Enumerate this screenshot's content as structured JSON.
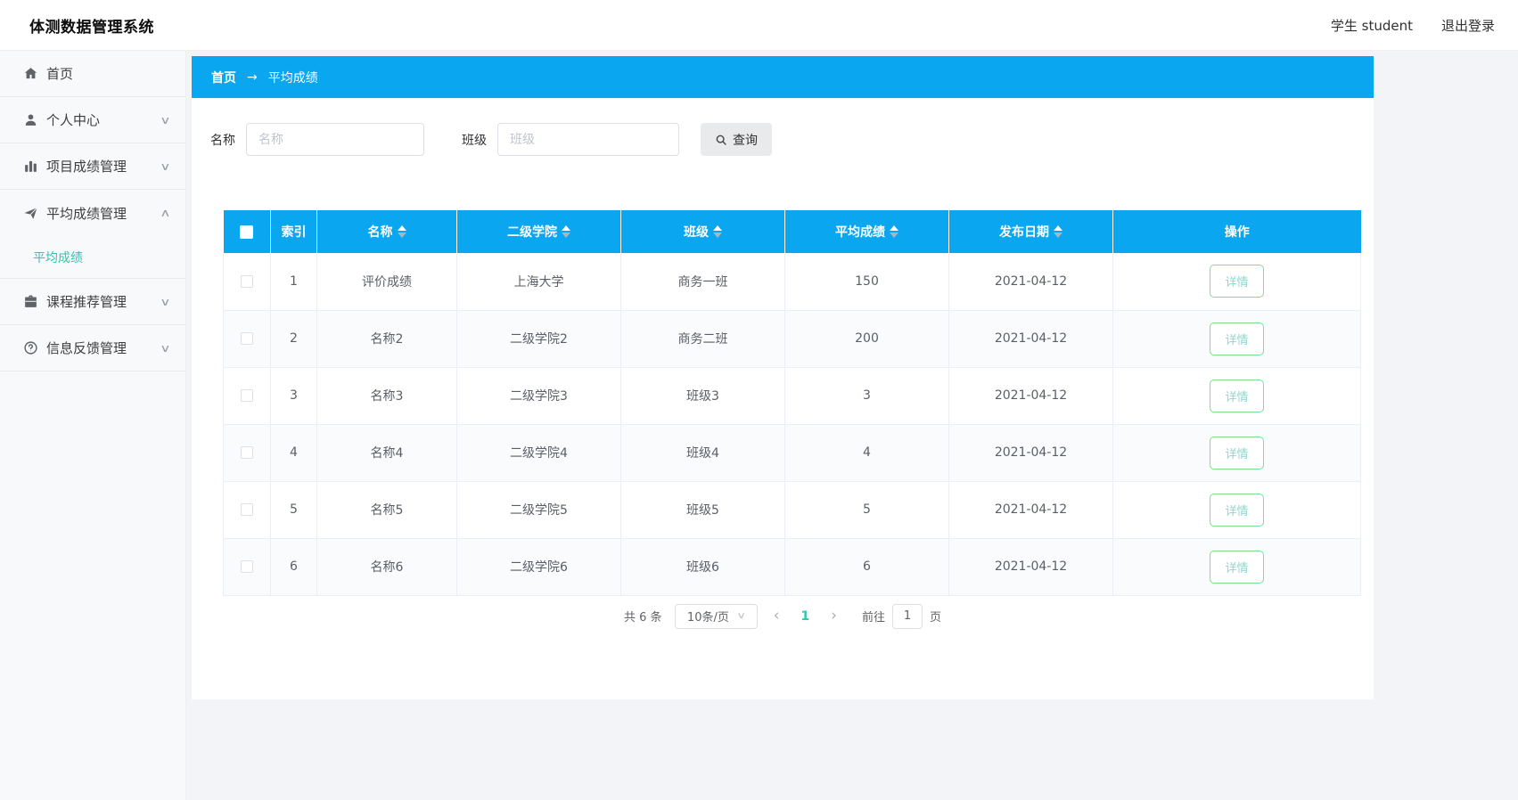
{
  "app": {
    "title": "体测数据管理系统"
  },
  "topbar": {
    "user": "学生 student",
    "logout": "退出登录"
  },
  "sidebar": {
    "items": [
      {
        "label": "首页",
        "icon": "home-icon",
        "expandable": false
      },
      {
        "label": "个人中心",
        "icon": "user-icon",
        "expandable": true,
        "expanded": false
      },
      {
        "label": "项目成绩管理",
        "icon": "bar-chart-icon",
        "expandable": true,
        "expanded": false
      },
      {
        "label": "平均成绩管理",
        "icon": "send-icon",
        "expandable": true,
        "expanded": true
      },
      {
        "label": "课程推荐管理",
        "icon": "briefcase-icon",
        "expandable": true,
        "expanded": false
      },
      {
        "label": "信息反馈管理",
        "icon": "question-circle-icon",
        "expandable": true,
        "expanded": false
      }
    ],
    "submenu": {
      "label": "平均成绩",
      "active": true,
      "active_color": "#2cc8af"
    }
  },
  "breadcrumb": {
    "home": "首页",
    "separator": "→",
    "current": "平均成绩"
  },
  "filters": {
    "name_label": "名称",
    "name_placeholder": "名称",
    "class_label": "班级",
    "class_placeholder": "班级",
    "search_button": "查询"
  },
  "table": {
    "columns": [
      {
        "label": "索引",
        "sortable": false
      },
      {
        "label": "名称",
        "sortable": true
      },
      {
        "label": "二级学院",
        "sortable": true
      },
      {
        "label": "班级",
        "sortable": true
      },
      {
        "label": "平均成绩",
        "sortable": true
      },
      {
        "label": "发布日期",
        "sortable": true
      },
      {
        "label": "操作",
        "sortable": false
      }
    ],
    "rows": [
      {
        "index": "1",
        "name": "评价成绩",
        "college": "上海大学",
        "class": "商务一班",
        "score": "150",
        "date": "2021-04-12",
        "action": "详情"
      },
      {
        "index": "2",
        "name": "名称2",
        "college": "二级学院2",
        "class": "商务二班",
        "score": "200",
        "date": "2021-04-12",
        "action": "详情"
      },
      {
        "index": "3",
        "name": "名称3",
        "college": "二级学院3",
        "class": "班级3",
        "score": "3",
        "date": "2021-04-12",
        "action": "详情"
      },
      {
        "index": "4",
        "name": "名称4",
        "college": "二级学院4",
        "class": "班级4",
        "score": "4",
        "date": "2021-04-12",
        "action": "详情"
      },
      {
        "index": "5",
        "name": "名称5",
        "college": "二级学院5",
        "class": "班级5",
        "score": "5",
        "date": "2021-04-12",
        "action": "详情"
      },
      {
        "index": "6",
        "name": "名称6",
        "college": "二级学院6",
        "class": "班级6",
        "score": "6",
        "date": "2021-04-12",
        "action": "详情"
      }
    ]
  },
  "pagination": {
    "total": "共 6 条",
    "page_size": "10条/页",
    "prev": "‹",
    "current_page": "1",
    "next": "›",
    "goto_label": "前往",
    "goto_value": "1",
    "page_label": "页"
  },
  "colors": {
    "accent_blue": "#0aa7f0",
    "active_teal": "#2cc8af",
    "detail_border_green": "#7de08e",
    "detail_text": "#8bd8ce",
    "page_background": "#f2f4f7",
    "stripe_row": "#fafbfd",
    "table_border": "#ebeef5"
  }
}
